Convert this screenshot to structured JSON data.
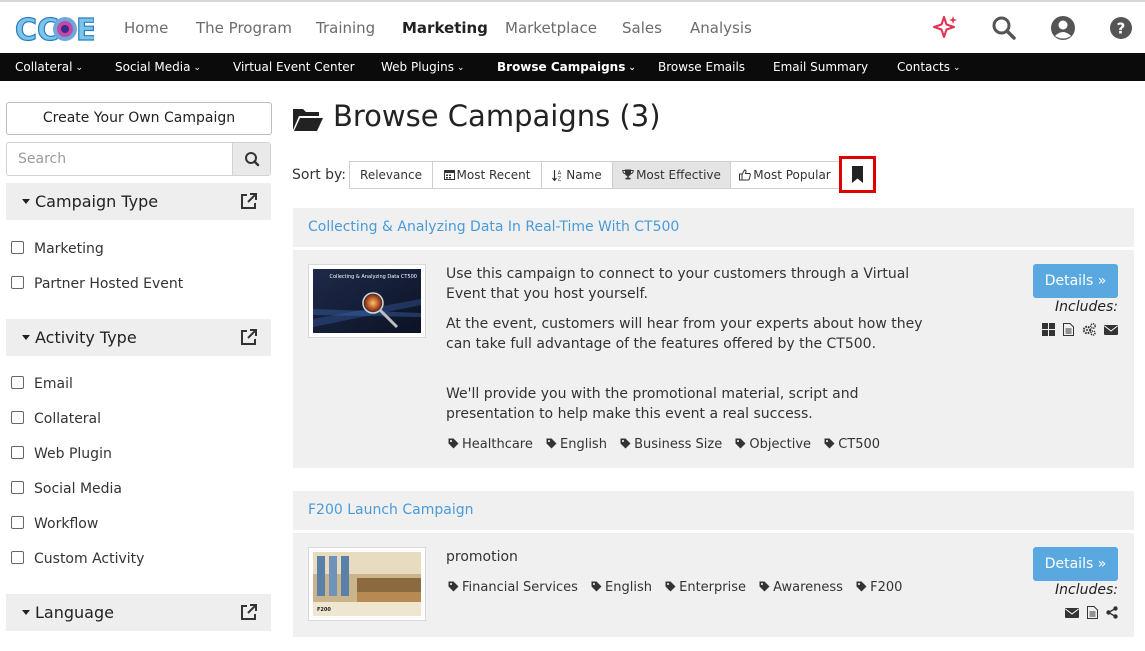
{
  "app": {
    "logo_text": "CCOE"
  },
  "topnav": {
    "items": [
      "Home",
      "The Program",
      "Training",
      "Marketing",
      "Marketplace",
      "Sales",
      "Analysis"
    ],
    "active": "Marketing",
    "icons": [
      "sparkle-icon",
      "search-icon",
      "user-icon",
      "help-icon"
    ]
  },
  "subnav": {
    "items": [
      {
        "label": "Collateral",
        "dropdown": true
      },
      {
        "label": "Social Media",
        "dropdown": true
      },
      {
        "label": "Virtual Event Center",
        "dropdown": false
      },
      {
        "label": "Web Plugins",
        "dropdown": true
      },
      {
        "label": "Browse Campaigns",
        "dropdown": true
      },
      {
        "label": "Browse Emails",
        "dropdown": false
      },
      {
        "label": "Email Summary",
        "dropdown": false
      },
      {
        "label": "Contacts",
        "dropdown": true
      }
    ],
    "active": "Browse Campaigns"
  },
  "sidebar": {
    "create_label": "Create Your Own Campaign",
    "search_placeholder": "Search",
    "facets": [
      {
        "title": "Campaign Type",
        "options": [
          "Marketing",
          "Partner Hosted Event"
        ]
      },
      {
        "title": "Activity Type",
        "options": [
          "Email",
          "Collateral",
          "Web Plugin",
          "Social Media",
          "Workflow",
          "Custom Activity"
        ]
      },
      {
        "title": "Language",
        "options": []
      }
    ]
  },
  "main": {
    "title": "Browse Campaigns (3)",
    "sort_label": "Sort by:",
    "sort_options": [
      {
        "label": "Relevance",
        "icon": ""
      },
      {
        "label": "Most Recent",
        "icon": "calendar-icon"
      },
      {
        "label": "Name",
        "icon": "sort-alpha-icon"
      },
      {
        "label": "Most Effective",
        "icon": "trophy-icon"
      },
      {
        "label": "Most Popular",
        "icon": "thumbs-up-icon"
      }
    ],
    "sort_active": "Most Effective",
    "bookmark_icon": "bookmark-icon"
  },
  "campaigns": [
    {
      "title": "Collecting & Analyzing Data In Real-Time With CT500",
      "thumb_caption": "Collecting & Analyzing Data CT500",
      "paragraphs": [
        "Use this campaign to connect to your customers through a Virtual Event that you host yourself.",
        "At the event, customers will hear from your experts about how they can take full advantage of the features offered by the CT500.",
        "We'll provide you with the promotional material, script and presentation to help make this event a real success."
      ],
      "tags": [
        "Healthcare",
        "English",
        "Business Size",
        "Objective",
        "CT500"
      ],
      "details_label": "Details »",
      "includes_label": "Includes:",
      "includes_icons": [
        "grid-icon",
        "document-icon",
        "cogs-icon",
        "envelope-icon"
      ]
    },
    {
      "title": "F200 Launch Campaign",
      "thumb_caption": "F200",
      "paragraphs": [
        "promotion"
      ],
      "tags": [
        "Financial Services",
        "English",
        "Enterprise",
        "Awareness",
        "F200"
      ],
      "details_label": "Details »",
      "includes_label": "Includes:",
      "includes_icons": [
        "envelope-icon",
        "document-icon",
        "share-icon"
      ]
    }
  ],
  "colors": {
    "link": "#4a9bd8",
    "details_button": "#5aa8e0",
    "subnav_bg": "#0b0b0b",
    "highlight": "#e00000"
  }
}
